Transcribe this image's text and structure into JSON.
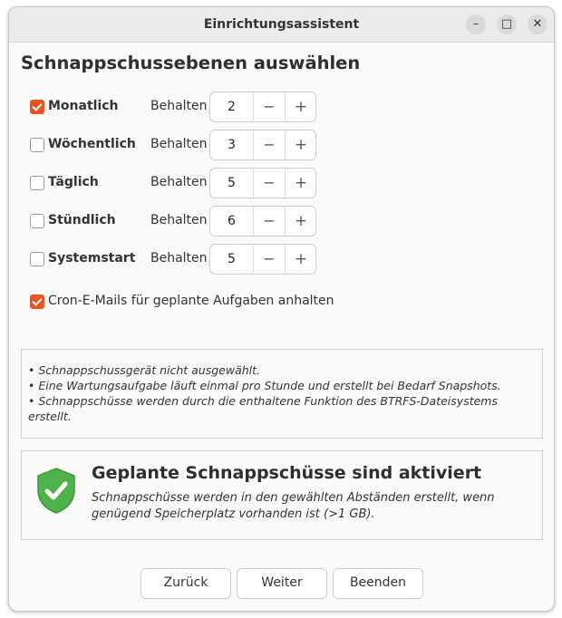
{
  "window": {
    "title": "Einrichtungsassistent",
    "controls": {
      "minimize": "–",
      "maximize": "□",
      "close": "✕"
    }
  },
  "heading": "Schnappschussebenen auswählen",
  "levels": [
    {
      "label": "Monatlich",
      "checked": true,
      "keep_label": "Behalten",
      "value": "2",
      "minus": "−",
      "plus": "+"
    },
    {
      "label": "Wöchentlich",
      "checked": false,
      "keep_label": "Behalten",
      "value": "3",
      "minus": "−",
      "plus": "+"
    },
    {
      "label": "Täglich",
      "checked": false,
      "keep_label": "Behalten",
      "value": "5",
      "minus": "−",
      "plus": "+"
    },
    {
      "label": "Stündlich",
      "checked": false,
      "keep_label": "Behalten",
      "value": "6",
      "minus": "−",
      "plus": "+"
    },
    {
      "label": "Systemstart",
      "checked": false,
      "keep_label": "Behalten",
      "value": "5",
      "minus": "−",
      "plus": "+"
    }
  ],
  "cron": {
    "label": "Cron-E-Mails für geplante Aufgaben anhalten",
    "checked": true
  },
  "info": [
    "• Schnappschussgerät nicht ausgewählt.",
    "• Eine Wartungsaufgabe läuft einmal pro Stunde und erstellt bei Bedarf Snapshots.",
    "• Schnappschüsse werden durch die enthaltene Funktion des BTRFS-Dateisystems erstellt."
  ],
  "status": {
    "title": "Geplante Schnappschüsse sind aktiviert",
    "description": "Schnappschüsse werden in den gewählten Abständen erstellt, wenn genügend Speicherplatz vorhanden ist (>1 GB).",
    "icon": "shield-check-icon"
  },
  "buttons": {
    "back": "Zurück",
    "next": "Weiter",
    "finish": "Beenden"
  },
  "colors": {
    "accent": "#e95420",
    "shield": "#4fb24b"
  }
}
